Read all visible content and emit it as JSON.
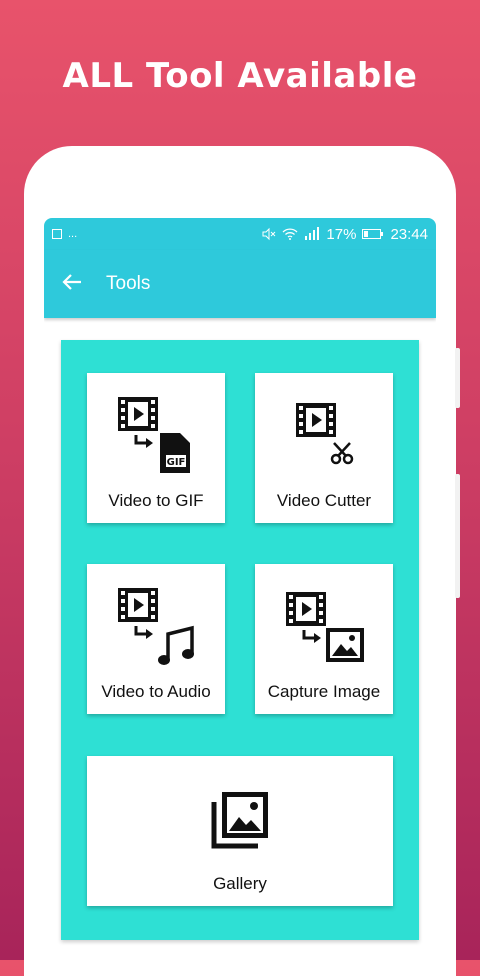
{
  "promo": {
    "headline": "ALL Tool Available"
  },
  "status_bar": {
    "left": "...",
    "battery_percent": "17%",
    "time": "23:44"
  },
  "app_bar": {
    "title": "Tools",
    "back_icon": "arrow-left-icon"
  },
  "tools": [
    {
      "label": "Video to GIF",
      "icon": "video-to-gif-icon"
    },
    {
      "label": "Video Cutter",
      "icon": "video-cutter-icon"
    },
    {
      "label": "Video to Audio",
      "icon": "video-to-audio-icon"
    },
    {
      "label": "Capture Image",
      "icon": "capture-image-icon"
    },
    {
      "label": "Gallery",
      "icon": "gallery-icon"
    }
  ],
  "colors": {
    "appbar": "#2ec9db",
    "panel": "#2ee0d4",
    "background_top": "#e8536b",
    "background_bottom": "#a8245a"
  }
}
